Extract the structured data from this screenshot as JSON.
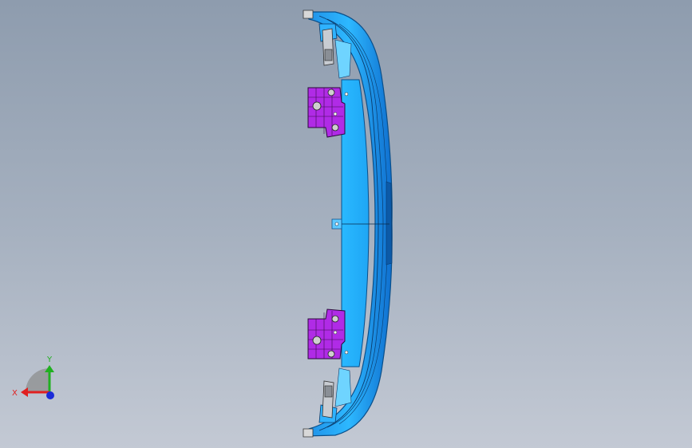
{
  "viewport": {
    "background_top": "#8e9cae",
    "background_bottom": "#c3c9d4"
  },
  "model": {
    "part_color": "#1fb0ff",
    "part_edge_color": "#0a4f8a",
    "bracket_color": "#b02be6",
    "bracket_edge_color": "#2a0a3a"
  },
  "triad": {
    "x_label": "X",
    "y_label": "Y",
    "x_color": "#e02020",
    "y_color": "#20b020",
    "z_color": "#1a2bd8"
  }
}
